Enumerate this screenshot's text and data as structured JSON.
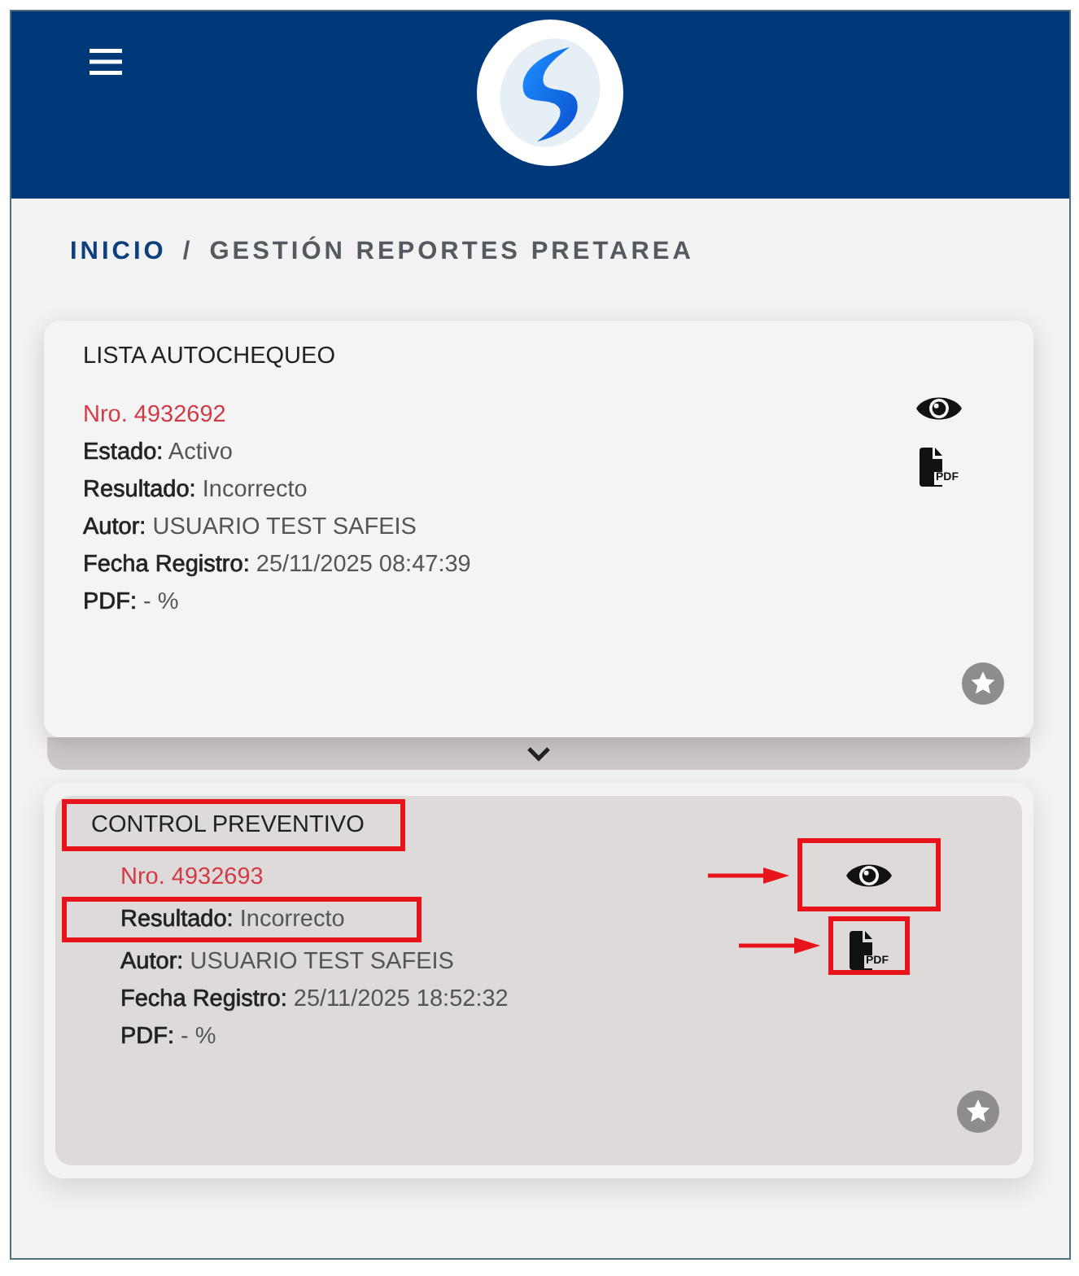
{
  "breadcrumb": [
    {
      "label": "INICIO",
      "current": false
    },
    {
      "label": "GESTIÓN REPORTES PRETAREA",
      "current": true
    }
  ],
  "breadcrumb_separator": "/",
  "reports": [
    {
      "kind": "card",
      "title": "LISTA AUTOCHEQUEO",
      "title_highlighted": false,
      "number": "Nro. 4932692",
      "fields": [
        {
          "label": "Estado:",
          "value": "Activo",
          "highlighted": false
        },
        {
          "label": "Resultado:",
          "value": "Incorrecto",
          "highlighted": false
        },
        {
          "label": "Autor:",
          "value": "USUARIO TEST SAFEIS",
          "highlighted": false
        },
        {
          "label": "Fecha Registro:",
          "value": "25/11/2025 08:47:39",
          "highlighted": false
        },
        {
          "label": "PDF:",
          "value": "- %",
          "highlighted": false
        }
      ],
      "actions": [
        {
          "kind": "view",
          "highlighted": false
        },
        {
          "kind": "pdf",
          "label": "PDF",
          "highlighted": false
        }
      ]
    },
    {
      "kind": "detail",
      "title": "CONTROL PREVENTIVO",
      "title_highlighted": true,
      "number": "Nro. 4932693",
      "fields": [
        {
          "label": "Resultado:",
          "value": "Incorrecto",
          "highlighted": true
        },
        {
          "label": "Autor:",
          "value": "USUARIO TEST SAFEIS",
          "highlighted": false
        },
        {
          "label": "Fecha Registro:",
          "value": "25/11/2025 18:52:32",
          "highlighted": false
        },
        {
          "label": "PDF:",
          "value": "- %",
          "highlighted": false
        }
      ],
      "actions": [
        {
          "kind": "view",
          "highlighted": true
        },
        {
          "kind": "pdf",
          "label": "PDF",
          "highlighted": true
        }
      ]
    }
  ]
}
